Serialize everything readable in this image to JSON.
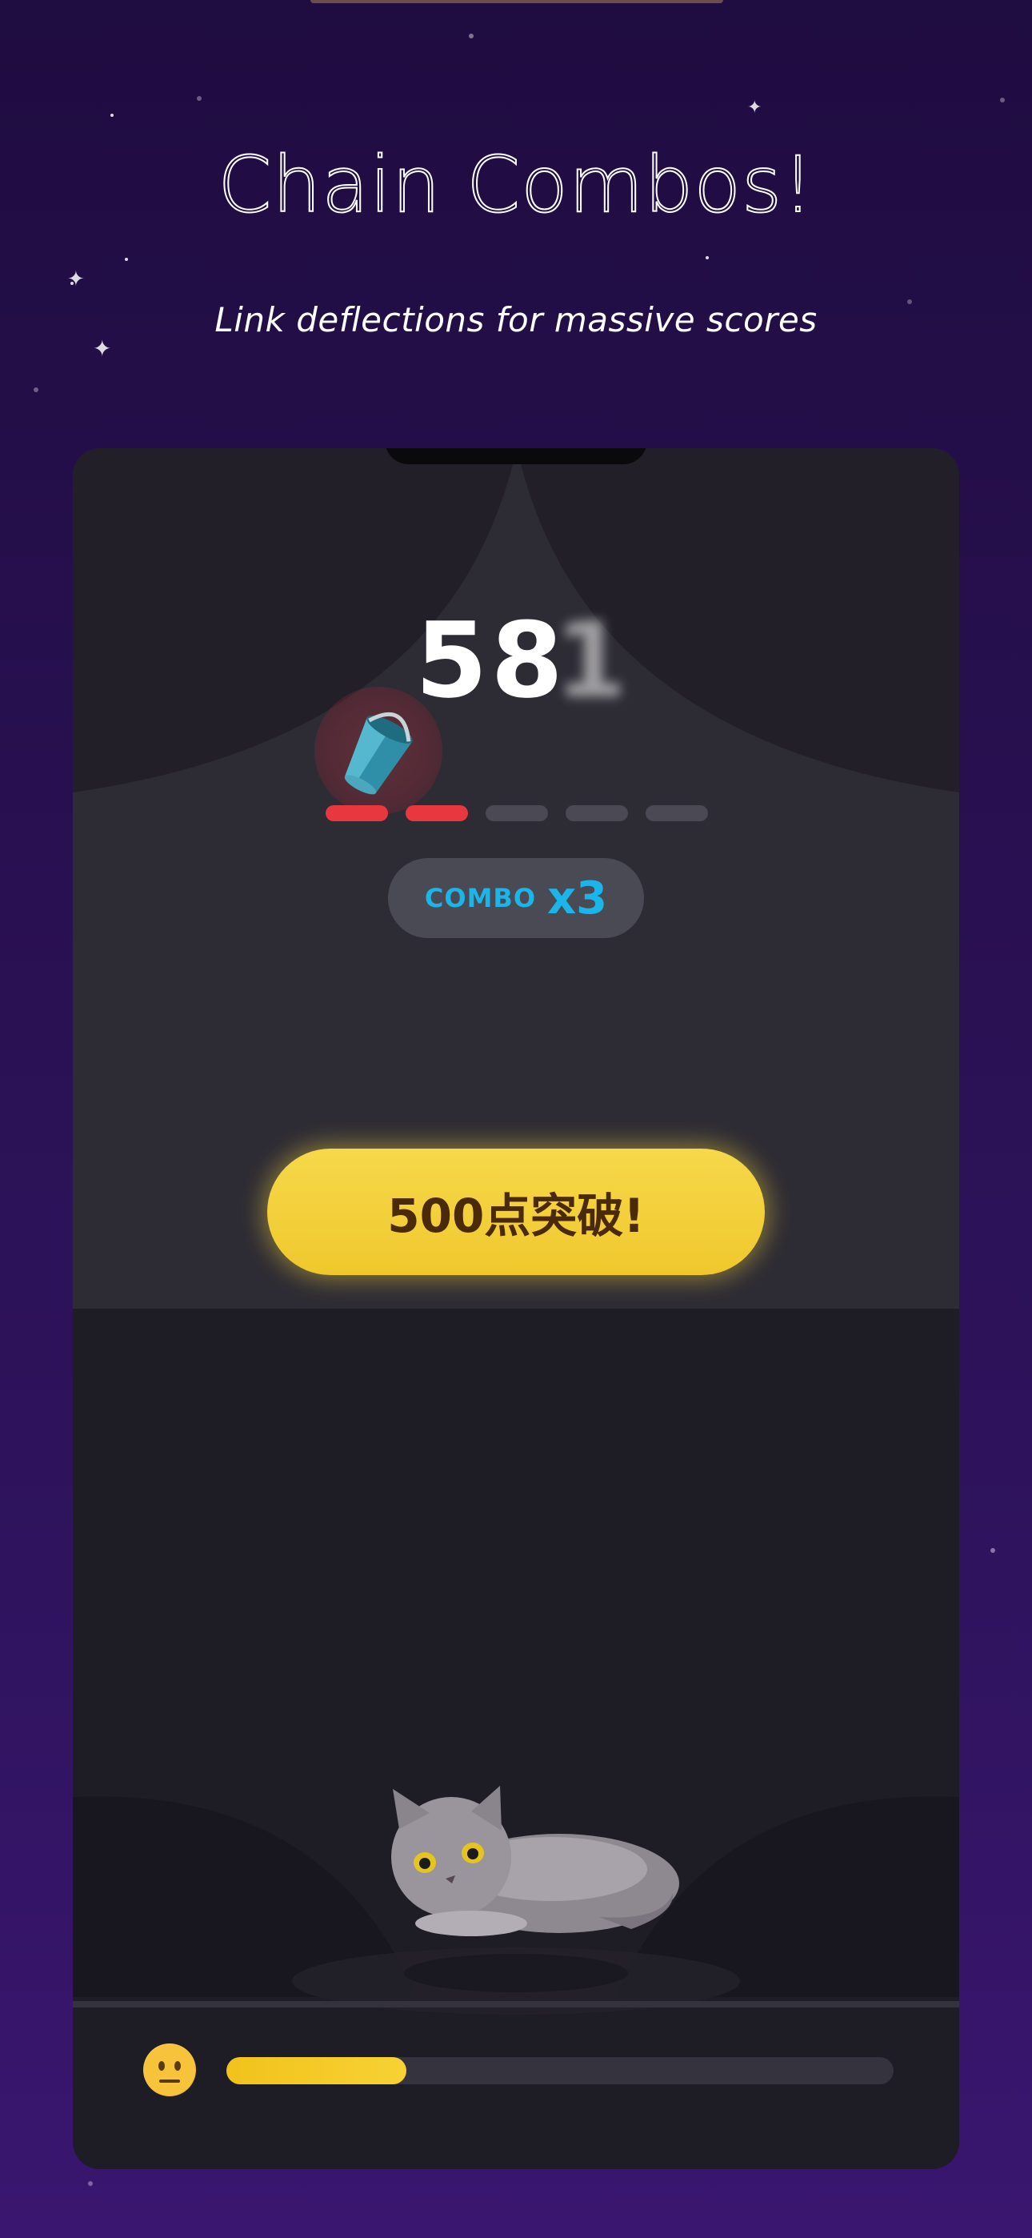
{
  "header": {
    "title": "Chain Combos!",
    "subtitle": "Link deflections for massive scores"
  },
  "game": {
    "score": "58",
    "score_next_digit": "1",
    "combo": {
      "label": "COMBO",
      "multiplier": "x3",
      "segments_total": 5,
      "segments_active": 2
    },
    "milestone_label": "500点突破!",
    "mood_icon": "neutral-face-icon",
    "mood_meter_fraction": 0.27
  },
  "colors": {
    "background": "#2a1056",
    "combo_accent": "#1ab6ea",
    "combo_active": "#e8373f",
    "milestone_button": "#f2cc35",
    "meter_fill": "#f2c21c"
  }
}
